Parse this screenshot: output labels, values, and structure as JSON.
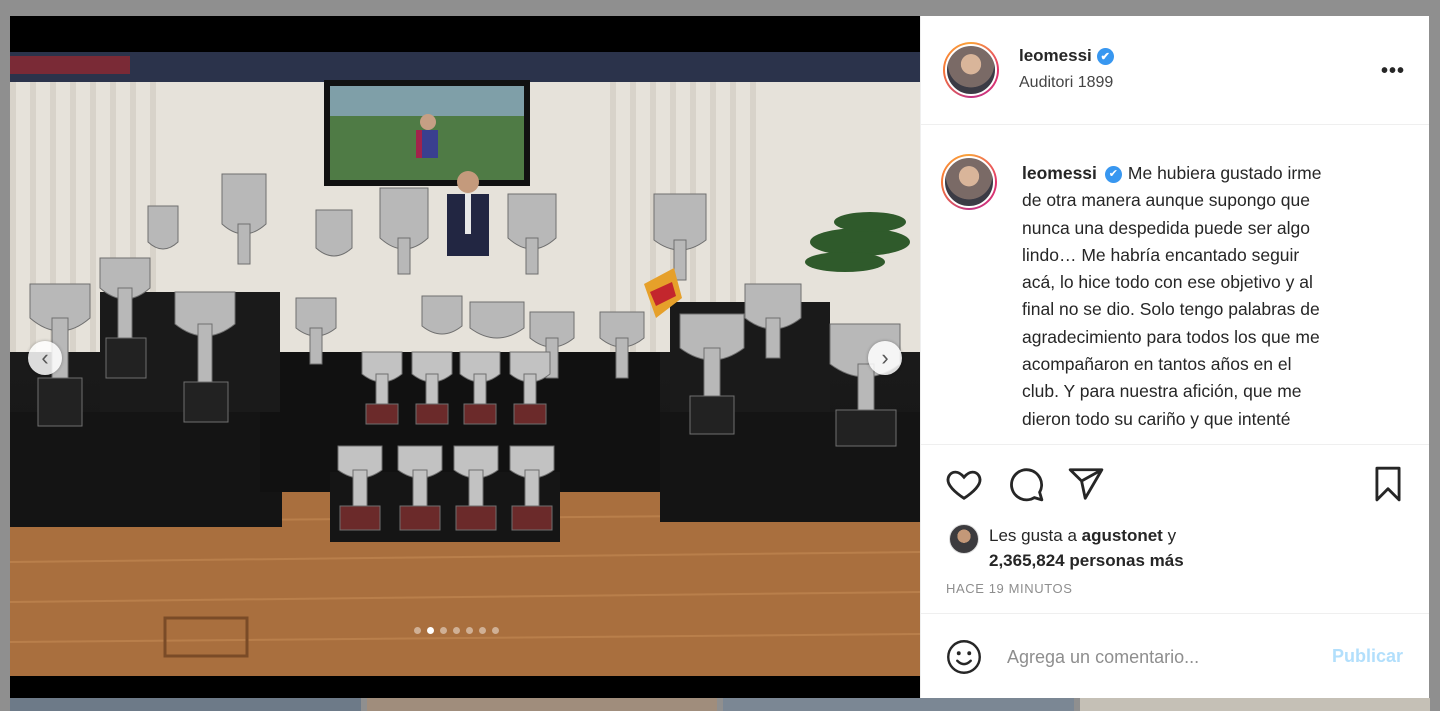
{
  "post": {
    "username": "leomessi",
    "location": "Auditori 1899",
    "caption_lines": [
      "Me hubiera gustado irme",
      "de otra manera aunque supongo que",
      "nunca una despedida puede ser algo",
      "lindo… Me habría encantado seguir",
      "acá, lo hice todo con ese objetivo y al",
      "final no se dio. Solo tengo palabras de",
      "agradecimiento para todos los que me",
      "acompañaron en tantos años en el",
      "club. Y para nuestra afición, que me",
      "dieron todo su cariño y que intenté"
    ],
    "likes": {
      "prefix": "Les gusta a ",
      "user": "agustonet",
      "mid": " y",
      "count": "2,365,824 personas más"
    },
    "time": "HACE 19 MINUTOS",
    "carousel": {
      "count": 7,
      "active_index": 1
    }
  },
  "comment": {
    "placeholder": "Agrega un comentario...",
    "publish_label": "Publicar"
  },
  "icons": {
    "more": "more-options-icon",
    "like": "heart-icon",
    "comment": "comment-icon",
    "share": "share-icon",
    "save": "bookmark-icon",
    "emoji": "emoji-icon",
    "verified": "verified-icon",
    "prev": "chevron-left-icon",
    "next": "chevron-right-icon"
  },
  "colors": {
    "verified": "#3897f0",
    "publish_disabled": "#b2dffc",
    "muted": "#8e8e8e"
  }
}
